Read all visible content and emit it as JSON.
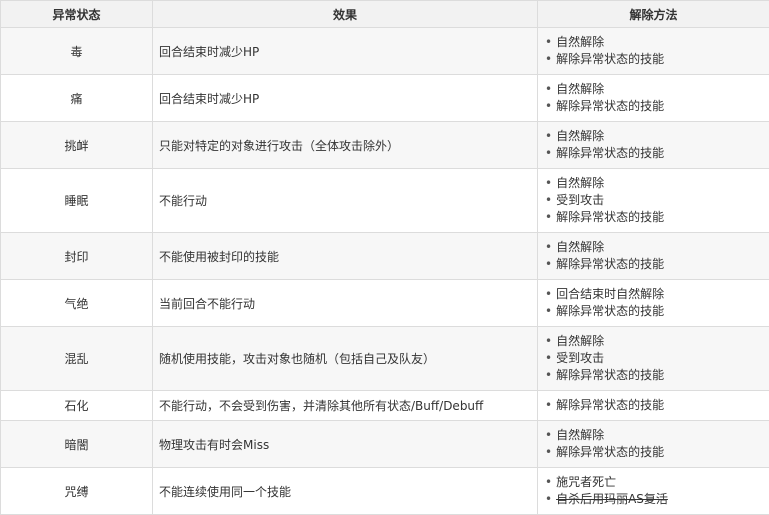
{
  "table": {
    "headers": {
      "status": "异常状态",
      "effect": "效果",
      "cure": "解除方法"
    },
    "rows": [
      {
        "status": "毒",
        "effect": "回合结束时减少HP",
        "cures": [
          "自然解除",
          "解除异常状态的技能"
        ]
      },
      {
        "status": "痛",
        "effect": "回合结束时减少HP",
        "cures": [
          "自然解除",
          "解除异常状态的技能"
        ]
      },
      {
        "status": "挑衅",
        "effect": "只能对特定的对象进行攻击（全体攻击除外）",
        "cures": [
          "自然解除",
          "解除异常状态的技能"
        ]
      },
      {
        "status": "睡眠",
        "effect": "不能行动",
        "cures": [
          "自然解除",
          "受到攻击",
          "解除异常状态的技能"
        ]
      },
      {
        "status": "封印",
        "effect": "不能使用被封印的技能",
        "cures": [
          "自然解除",
          "解除异常状态的技能"
        ]
      },
      {
        "status": "气绝",
        "effect": "当前回合不能行动",
        "cures": [
          "回合结束时自然解除",
          "解除异常状态的技能"
        ]
      },
      {
        "status": "混乱",
        "effect": "随机使用技能，攻击对象也随机（包括自己及队友）",
        "cures": [
          "自然解除",
          "受到攻击",
          "解除异常状态的技能"
        ]
      },
      {
        "status": "石化",
        "effect": "不能行动，不会受到伤害，并清除其他所有状态/Buff/Debuff",
        "cures": [
          "解除异常状态的技能"
        ]
      },
      {
        "status": "暗闇",
        "effect": "物理攻击有时会Miss",
        "cures": [
          "自然解除",
          "解除异常状态的技能"
        ]
      },
      {
        "status": "咒缚",
        "effect": "不能连续使用同一个技能",
        "cures": [
          "施咒者死亡",
          "自杀后用玛丽AS复活"
        ]
      }
    ]
  }
}
